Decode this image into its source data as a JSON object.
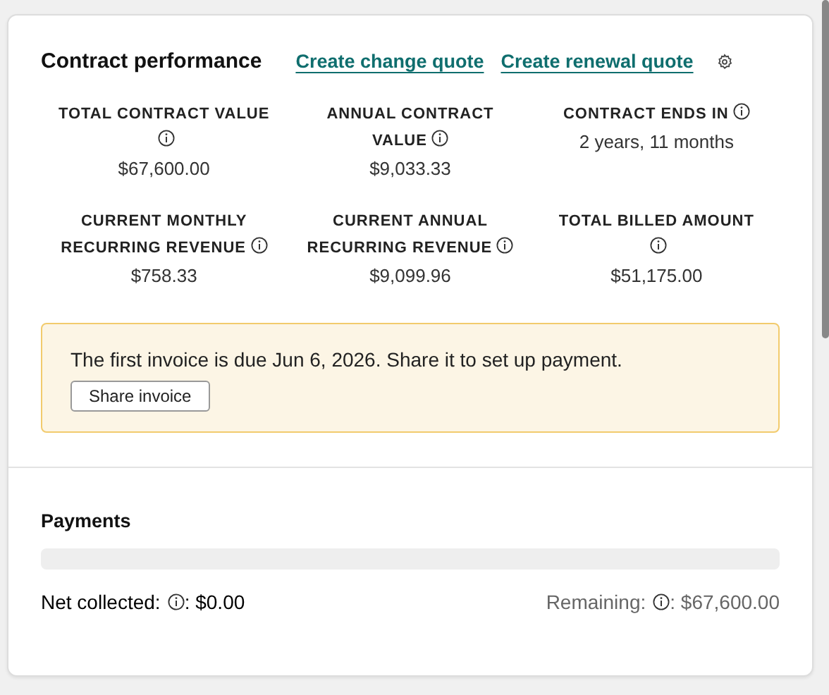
{
  "card": {
    "title": "Contract performance",
    "links": [
      "Create change quote",
      "Create renewal quote"
    ],
    "metrics": [
      {
        "label": "TOTAL CONTRACT VALUE",
        "value": "$67,600.00"
      },
      {
        "label": "ANNUAL CONTRACT VALUE",
        "value": "$9,033.33"
      },
      {
        "label": "CONTRACT ENDS IN",
        "value": "2 years, 11 months"
      },
      {
        "label": "CURRENT MONTHLY RECURRING REVENUE",
        "value": "$758.33"
      },
      {
        "label": "CURRENT ANNUAL RECURRING REVENUE",
        "value": "$9,099.96"
      },
      {
        "label": "TOTAL BILLED AMOUNT",
        "value": "$51,175.00"
      }
    ],
    "notice": {
      "message": "The first invoice is due Jun 6, 2026. Share it to set up payment.",
      "button": "Share invoice"
    }
  },
  "payments": {
    "title": "Payments",
    "level": 0,
    "collected": {
      "label": "Net collected:",
      "value": ": $0.00"
    },
    "remaining": {
      "label": "Remaining:",
      "value": ": $67,600.00"
    }
  }
}
